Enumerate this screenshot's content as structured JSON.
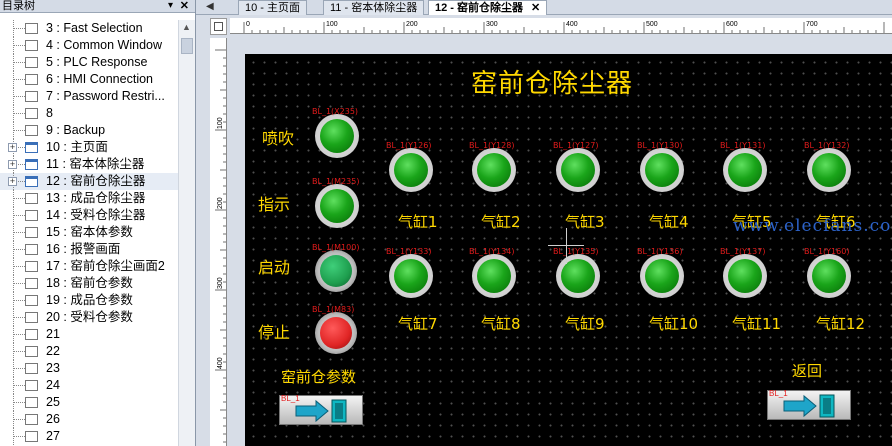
{
  "tree": {
    "title": "目录树",
    "items": [
      {
        "label": "3 : Fast Selection",
        "type": "plain",
        "selected": false,
        "expandable": false
      },
      {
        "label": "4 : Common Window",
        "type": "plain",
        "selected": false,
        "expandable": false
      },
      {
        "label": "5 : PLC Response",
        "type": "plain",
        "selected": false,
        "expandable": false
      },
      {
        "label": "6 : HMI Connection",
        "type": "plain",
        "selected": false,
        "expandable": false
      },
      {
        "label": "7 : Password Restri...",
        "type": "plain",
        "selected": false,
        "expandable": false
      },
      {
        "label": "8",
        "type": "plain",
        "selected": false,
        "expandable": false
      },
      {
        "label": "9 : Backup",
        "type": "plain",
        "selected": false,
        "expandable": false
      },
      {
        "label": "10 : 主页面",
        "type": "blue",
        "selected": false,
        "expandable": true
      },
      {
        "label": "11 : 窑本体除尘器",
        "type": "blue",
        "selected": false,
        "expandable": true
      },
      {
        "label": "12 : 窑前仓除尘器",
        "type": "blue",
        "selected": true,
        "expandable": true
      },
      {
        "label": "13 : 成品仓除尘器",
        "type": "plain",
        "selected": false,
        "expandable": false
      },
      {
        "label": "14 : 受料仓除尘器",
        "type": "plain",
        "selected": false,
        "expandable": false
      },
      {
        "label": "15 : 窑本体参数",
        "type": "plain",
        "selected": false,
        "expandable": false
      },
      {
        "label": "16 : 报警画面",
        "type": "plain",
        "selected": false,
        "expandable": false
      },
      {
        "label": "17 : 窑前仓除尘画面2",
        "type": "plain",
        "selected": false,
        "expandable": false
      },
      {
        "label": "18 : 窑前仓参数",
        "type": "plain",
        "selected": false,
        "expandable": false
      },
      {
        "label": "19 : 成品仓参数",
        "type": "plain",
        "selected": false,
        "expandable": false
      },
      {
        "label": "20 : 受料仓参数",
        "type": "plain",
        "selected": false,
        "expandable": false
      },
      {
        "label": "21",
        "type": "plain",
        "selected": false,
        "expandable": false
      },
      {
        "label": "22",
        "type": "plain",
        "selected": false,
        "expandable": false
      },
      {
        "label": "23",
        "type": "plain",
        "selected": false,
        "expandable": false
      },
      {
        "label": "24",
        "type": "plain",
        "selected": false,
        "expandable": false
      },
      {
        "label": "25",
        "type": "plain",
        "selected": false,
        "expandable": false
      },
      {
        "label": "26",
        "type": "plain",
        "selected": false,
        "expandable": false
      },
      {
        "label": "27",
        "type": "plain",
        "selected": false,
        "expandable": false
      }
    ]
  },
  "tabs": [
    {
      "label": "10 - 主页面",
      "active": false
    },
    {
      "label": "11 - 窑本体除尘器",
      "active": false
    },
    {
      "label": "12 - 窑前仓除尘器",
      "active": true
    }
  ],
  "ruler": {
    "top_labels": [
      "0",
      "100",
      "200",
      "300",
      "400",
      "500",
      "600",
      "700"
    ],
    "left_labels": [
      "100",
      "200",
      "300",
      "400"
    ]
  },
  "screen": {
    "title": "窑前仓除尘器",
    "controls": {
      "blow": {
        "label": "喷吹",
        "tag": "BL_1(X235)"
      },
      "indicate": {
        "label": "指示",
        "tag": "BL_1(M235)"
      },
      "start": {
        "label": "启动",
        "tag": "BL_1(M100)",
        "color": "#1e9e4e"
      },
      "stop": {
        "label": "停止",
        "tag": "BL_1(M83)",
        "color": "#e02525"
      }
    },
    "cylinders_row1": [
      {
        "label": "气缸1",
        "tag": "BL_1(Y126)"
      },
      {
        "label": "气缸2",
        "tag": "BL_1(Y128)"
      },
      {
        "label": "气缸3",
        "tag": "BL_1(Y127)"
      },
      {
        "label": "气缸4",
        "tag": "BL_1(Y130)"
      },
      {
        "label": "气缸5",
        "tag": "BL_1(Y131)"
      },
      {
        "label": "气缸6",
        "tag": "BL_1(Y132)"
      }
    ],
    "cylinders_row2": [
      {
        "label": "气缸7",
        "tag": "BL_1(Y133)"
      },
      {
        "label": "气缸8",
        "tag": "BL_1(Y134)"
      },
      {
        "label": "气缸9",
        "tag": "BL_1(Y135)"
      },
      {
        "label": "气缸10",
        "tag": "BL_1(Y136)"
      },
      {
        "label": "气缸11",
        "tag": "BL_1(Y137)"
      },
      {
        "label": "气缸12",
        "tag": "BL_1(Y160)"
      }
    ],
    "nav_params_label": "窑前仓参数",
    "nav_back_label": "返回",
    "nav_tag": "BL_1",
    "watermark": "www.elecfans.com"
  },
  "colors": {
    "lamp_green": "#1aa51a",
    "text_yellow": "#ffd800",
    "tag_red": "#e21b1b"
  }
}
